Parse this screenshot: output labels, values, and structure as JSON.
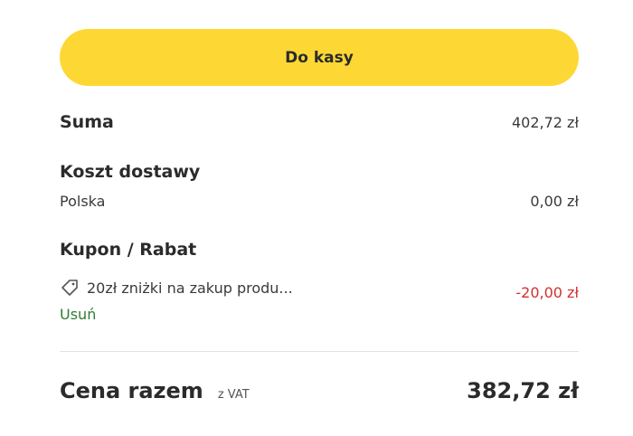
{
  "checkout_button": {
    "label": "Do kasy",
    "color": "#fdd835"
  },
  "sum": {
    "label": "Suma",
    "value": "402,72 zł"
  },
  "shipping": {
    "label": "Koszt dostawy",
    "country": "Polska",
    "value": "0,00 zł"
  },
  "coupon": {
    "label": "Kupon / Rabat",
    "icon": "tag-icon",
    "description": "20zł zniżki na zakup produ...",
    "value": "-20,00 zł",
    "value_color": "#d32f2f",
    "remove_label": "Usuń",
    "remove_color": "#2e7d32"
  },
  "total": {
    "label": "Cena razem",
    "vat_note": "z VAT",
    "value": "382,72 zł"
  }
}
